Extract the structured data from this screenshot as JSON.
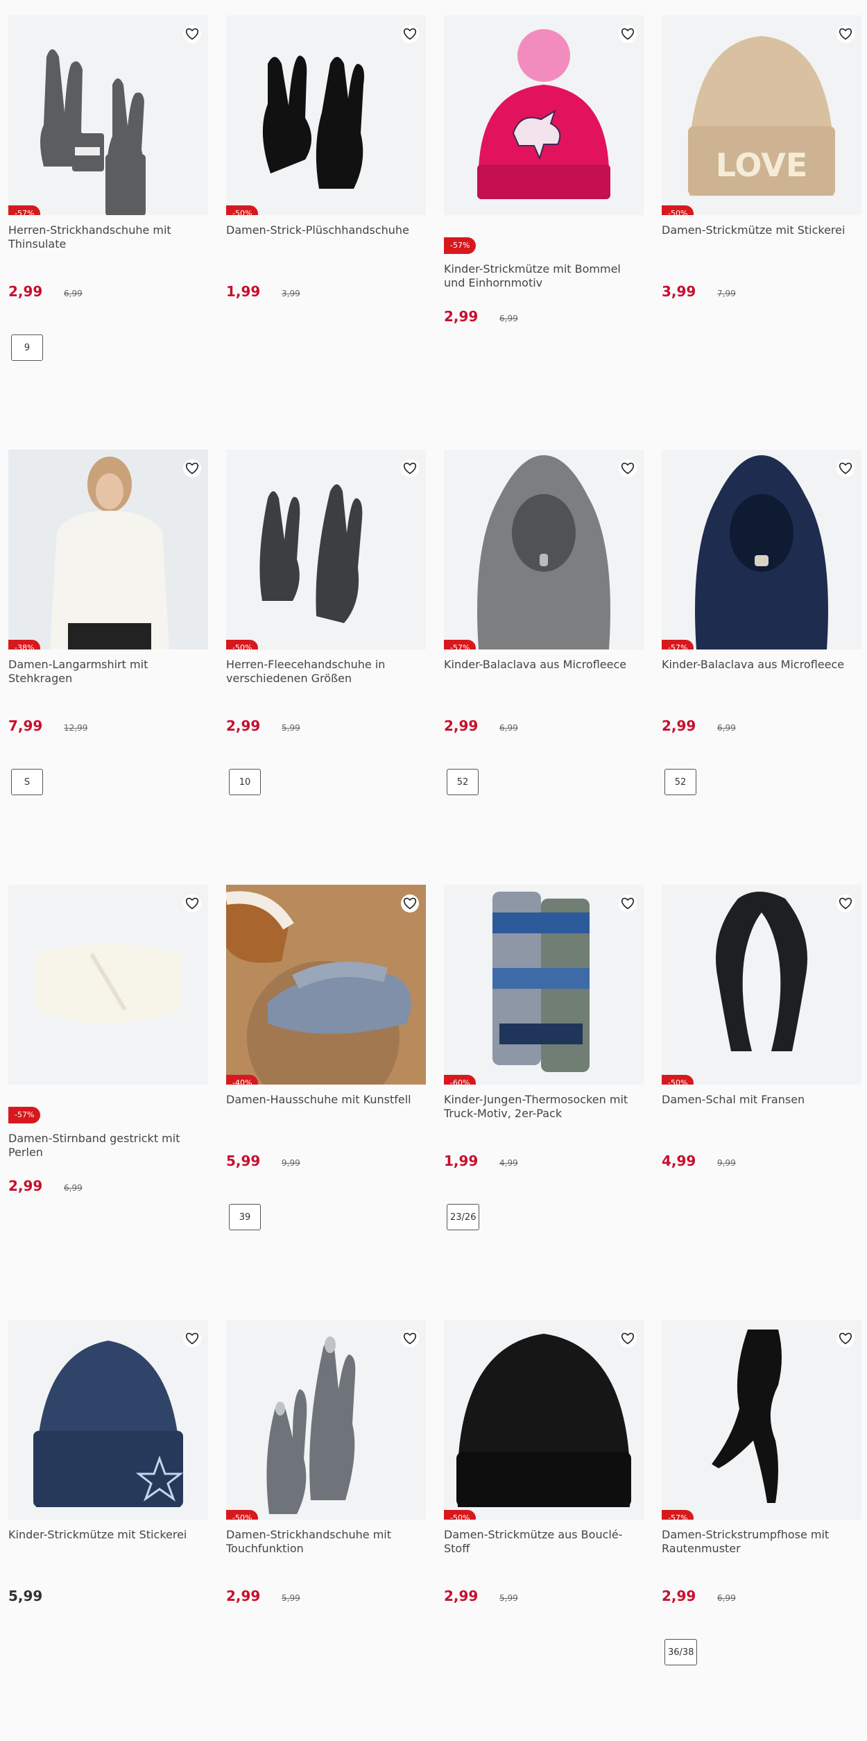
{
  "colors": {
    "sale_red": "#c8102e",
    "badge_red": "#d7191e",
    "text": "#333333",
    "image_bg": "#f1f3f4"
  },
  "icons": {
    "favorite": "heart-outline-icon"
  },
  "products": [
    {
      "title": "Herren-Strickhandschuhe mit Thinsulate",
      "badge": "-57%",
      "price": "2,99",
      "old_price": "6,99",
      "size": "9",
      "image": "gray-knit-gloves"
    },
    {
      "title": "Damen-Strick-Plüschhandschuhe",
      "badge": "-50%",
      "price": "1,99",
      "old_price": "3,99",
      "size": "",
      "image": "black-plush-gloves"
    },
    {
      "title": "Kinder-Strickmütze mit Bommel und Einhornmotiv",
      "badge": "-57%",
      "price": "2,99",
      "old_price": "6,99",
      "size": "",
      "image": "pink-unicorn-beanie"
    },
    {
      "title": "Damen-Strickmütze mit Stickerei",
      "badge": "-50%",
      "price": "3,99",
      "old_price": "7,99",
      "size": "",
      "image": "beige-love-beanie"
    },
    {
      "title": "Damen-Langarmshirt mit Stehkragen",
      "badge": "-38%",
      "price": "7,99",
      "old_price": "12,99",
      "size": "S",
      "image": "white-longsleeve-shirt"
    },
    {
      "title": "Herren-Fleecehandschuhe in verschiedenen Größen",
      "badge": "-50%",
      "price": "2,99",
      "old_price": "5,99",
      "size": "10",
      "image": "dark-fleece-gloves"
    },
    {
      "title": "Kinder-Balaclava aus Microfleece",
      "badge": "-57%",
      "price": "2,99",
      "old_price": "6,99",
      "size": "52",
      "image": "gray-balaclava"
    },
    {
      "title": "Kinder-Balaclava aus Microfleece",
      "badge": "-57%",
      "price": "2,99",
      "old_price": "6,99",
      "size": "52",
      "image": "navy-balaclava"
    },
    {
      "title": "Damen-Stirnband gestrickt mit Perlen",
      "badge": "-57%",
      "price": "2,99",
      "old_price": "6,99",
      "size": "",
      "image": "cream-headband"
    },
    {
      "title": "Damen-Hausschuhe mit Kunstfell",
      "badge": "-40%",
      "price": "5,99",
      "old_price": "9,99",
      "size": "39",
      "image": "house-slippers"
    },
    {
      "title": "Kinder-Jungen-Thermosocken mit Truck-Motiv, 2er-Pack",
      "badge": "-60%",
      "price": "1,99",
      "old_price": "4,99",
      "size": "23/26",
      "image": "truck-socks"
    },
    {
      "title": "Damen-Schal mit Fransen",
      "badge": "-50%",
      "price": "4,99",
      "old_price": "9,99",
      "size": "",
      "image": "black-fringe-scarf"
    },
    {
      "title": "Kinder-Strickmütze mit Stickerei",
      "badge": "",
      "price": "5,99",
      "old_price": "",
      "size": "",
      "image": "navy-star-beanie"
    },
    {
      "title": "Damen-Strickhandschuhe mit Touchfunktion",
      "badge": "-50%",
      "price": "2,99",
      "old_price": "5,99",
      "size": "",
      "image": "gray-touch-gloves"
    },
    {
      "title": "Damen-Strickmütze aus Bouclé-Stoff",
      "badge": "-50%",
      "price": "2,99",
      "old_price": "5,99",
      "size": "",
      "image": "black-boucle-beanie"
    },
    {
      "title": "Damen-Strickstrumpfhose mit Rautenmuster",
      "badge": "-57%",
      "price": "2,99",
      "old_price": "6,99",
      "size": "36/38",
      "image": "black-tights"
    }
  ]
}
